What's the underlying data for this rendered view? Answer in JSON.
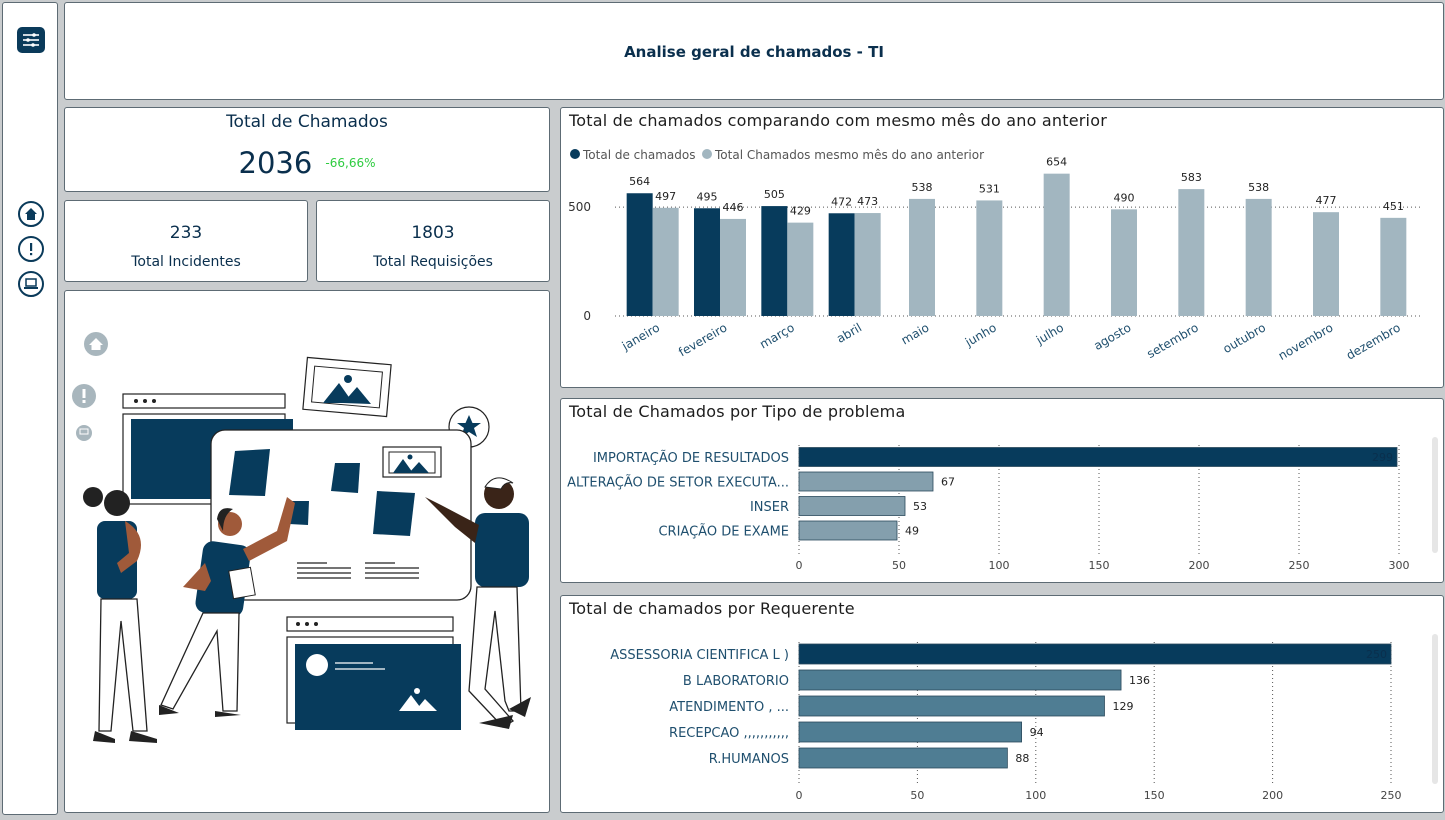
{
  "header": {
    "title": "Analise geral de chamados - TI"
  },
  "sidebar": {
    "menu_icon": "sliders-icon",
    "items": [
      {
        "icon": "home-icon"
      },
      {
        "icon": "alert-icon"
      },
      {
        "icon": "laptop-icon"
      }
    ]
  },
  "kpis": {
    "total": {
      "label": "Total de Chamados",
      "value": "2036",
      "delta": "-66,66%",
      "delta_color": "#2ecc40"
    },
    "incidentes": {
      "label": "Total Incidentes",
      "value": "233"
    },
    "requisicoes": {
      "label": "Total Requisições",
      "value": "1803"
    }
  },
  "colors": {
    "dark": "#073b5c",
    "light": "#a2b6c0",
    "mid": "#4f7d93",
    "bar_tipo_light": "#849fad"
  },
  "chart_data": [
    {
      "type": "bar",
      "title": "Total de chamados comparando com mesmo mês do ano anterior",
      "categories": [
        "janeiro",
        "fevereiro",
        "março",
        "abril",
        "maio",
        "junho",
        "julho",
        "agosto",
        "setembro",
        "outubro",
        "novembro",
        "dezembro"
      ],
      "series": [
        {
          "name": "Total de chamados",
          "values": [
            564,
            495,
            505,
            472,
            null,
            null,
            null,
            null,
            null,
            null,
            null,
            null
          ]
        },
        {
          "name": "Total Chamados mesmo mês do ano anterior",
          "values": [
            497,
            446,
            429,
            473,
            538,
            531,
            654,
            490,
            583,
            538,
            477,
            451
          ]
        }
      ],
      "yticks": [
        0,
        500
      ],
      "ylim": [
        0,
        680
      ],
      "legend": "top-left",
      "grid": "dotted"
    },
    {
      "type": "bar",
      "orientation": "horizontal",
      "title": "Total de Chamados por Tipo de problema",
      "categories": [
        "IMPORTAÇÃO DE RESULTADOS",
        "ALTERAÇÃO DE SETOR EXECUTA...",
        "INSER",
        "CRIAÇÃO DE EXAME"
      ],
      "values": [
        299,
        67,
        53,
        49
      ],
      "value_labels": [
        "299",
        "67",
        "53",
        "49"
      ],
      "xticks": [
        0,
        50,
        100,
        150,
        200,
        250,
        300
      ],
      "xlim": [
        0,
        300
      ]
    },
    {
      "type": "bar",
      "orientation": "horizontal",
      "title": "Total de chamados por Requerente",
      "categories": [
        "ASSESSORIA CIENTIFICA L     )",
        "B LABORATORIO",
        "ATENDIMENTO ,                          ...",
        "RECEPCAO ,,,,,,,,,,,",
        "R.HUMANOS"
      ],
      "values": [
        250,
        136,
        129,
        94,
        88
      ],
      "value_labels": [
        "250",
        "136",
        "129",
        "94",
        "88"
      ],
      "xticks": [
        0,
        50,
        100,
        150,
        200,
        250
      ],
      "xlim": [
        0,
        250
      ]
    }
  ]
}
